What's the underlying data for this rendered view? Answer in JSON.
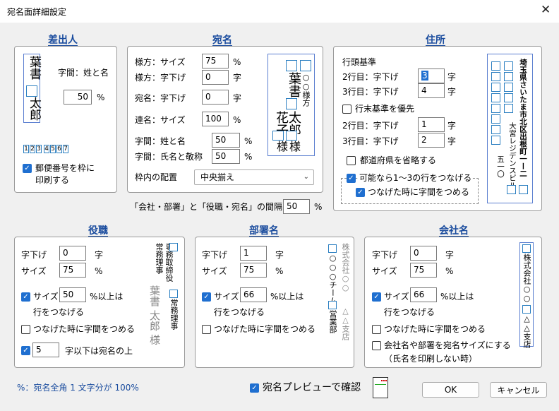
{
  "window": {
    "title": "宛名面詳細設定",
    "close": "✕"
  },
  "sender": {
    "header": "差出人",
    "name_top": "葉書",
    "name_bottom": "太郎",
    "gap_label": "字間：姓と名",
    "gap_value": "50",
    "gap_unit": "%",
    "postal_digits": [
      "1",
      "2",
      "3",
      "4",
      "5",
      "6",
      "7"
    ],
    "postal_check_label": "郵便番号を枠に\n印刷する"
  },
  "recipient": {
    "header": "宛名",
    "honorific_size_label": "様方：サイズ",
    "honorific_size_value": "75",
    "honorific_indent_label": "様方：字下げ",
    "honorific_indent_value": "0",
    "name_indent_label": "宛名：字下げ",
    "name_indent_value": "0",
    "joint_size_label": "連名：サイズ",
    "joint_size_value": "100",
    "gap_sei_label": "字間：姓と名",
    "gap_sei_value": "50",
    "gap_honor_label": "字間：氏名と敬称",
    "gap_honor_value": "50",
    "align_label": "枠内の配置",
    "align_value": "中央揃え",
    "unit_pct": "%",
    "unit_ji": "字",
    "preview_honorific": "○○様方",
    "preview_sei": "葉書",
    "preview_name1": "太郎",
    "preview_name2": "花子",
    "preview_sama1": "様",
    "preview_sama2": "様"
  },
  "spacing": {
    "label": "「会社・部署」と「役職・宛名」の間隔",
    "value": "50",
    "unit": "%"
  },
  "address": {
    "header": "住所",
    "base_label": "行頭基準",
    "l2_label": "2行目：字下げ",
    "l2_value": "3",
    "l3_label": "3行目：字下げ",
    "l3_value": "4",
    "end_base_label": "行末基準を優先",
    "e2_label": "2行目：字下げ",
    "e2_value": "1",
    "e3_label": "3行目：字下げ",
    "e3_value": "2",
    "omit_pref_label": "都道府県を省略する",
    "connect_label": "可能なら1～3の行をつなげる",
    "connect_gap_label": "つなげた時に字間をつめる",
    "unit_ji": "字",
    "preview_line1": "埼玉県さいたま市北区出根町一ー二",
    "preview_line2": "大宮レジデンスビル",
    "preview_line3": "五一〇"
  },
  "title_section": {
    "header": "役職",
    "indent_label": "字下げ",
    "indent_value": "0",
    "size_label": "サイズ",
    "size_value": "75",
    "size_check_label": "サイズ",
    "size_check_value": "50",
    "size_check_suffix": "%以上は",
    "size_check_line2": "行をつなげる",
    "connect_gap_label": "つなげた時に字間をつめる",
    "under_value": "5",
    "under_suffix": "字以下は宛名の上",
    "unit_ji": "字",
    "unit_pct": "%",
    "preview_a": "専務取締役",
    "preview_b": "常務理事",
    "preview_c": "常務理事",
    "preview_d": "専務取締役",
    "preview_e": "葉書 太郎 様"
  },
  "dept": {
    "header": "部署名",
    "indent_label": "字下げ",
    "indent_value": "1",
    "size_label": "サイズ",
    "size_value": "75",
    "size_check_label": "サイズ",
    "size_check_value": "66",
    "size_check_suffix": "%以上は",
    "size_check_line2": "行をつなげる",
    "connect_gap_label": "つなげた時に字間をつめる",
    "unit_ji": "字",
    "unit_pct": "%",
    "preview_a": "○○○チーム",
    "preview_b": "営業部",
    "preview_c": "株式会社○○",
    "preview_d": "△△支店"
  },
  "company": {
    "header": "会社名",
    "indent_label": "字下げ",
    "indent_value": "0",
    "size_label": "サイズ",
    "size_value": "75",
    "size_check_label": "サイズ",
    "size_check_value": "66",
    "size_check_suffix": "%以上は",
    "size_check_line2": "行をつなげる",
    "connect_gap_label": "つなげた時に字間をつめる",
    "to_recipient_label": "会社名や部署を宛名サイズにする",
    "to_recipient_sub": "（氏名を印刷しない時）",
    "unit_ji": "字",
    "unit_pct": "%",
    "preview_a": "株式会社○○○",
    "preview_b": "△△支店"
  },
  "footer": {
    "note": "%：宛名全角 1 文字分が 100%",
    "preview_check_label": "宛名プレビューで確認",
    "ok": "OK",
    "cancel": "キャンセル"
  }
}
